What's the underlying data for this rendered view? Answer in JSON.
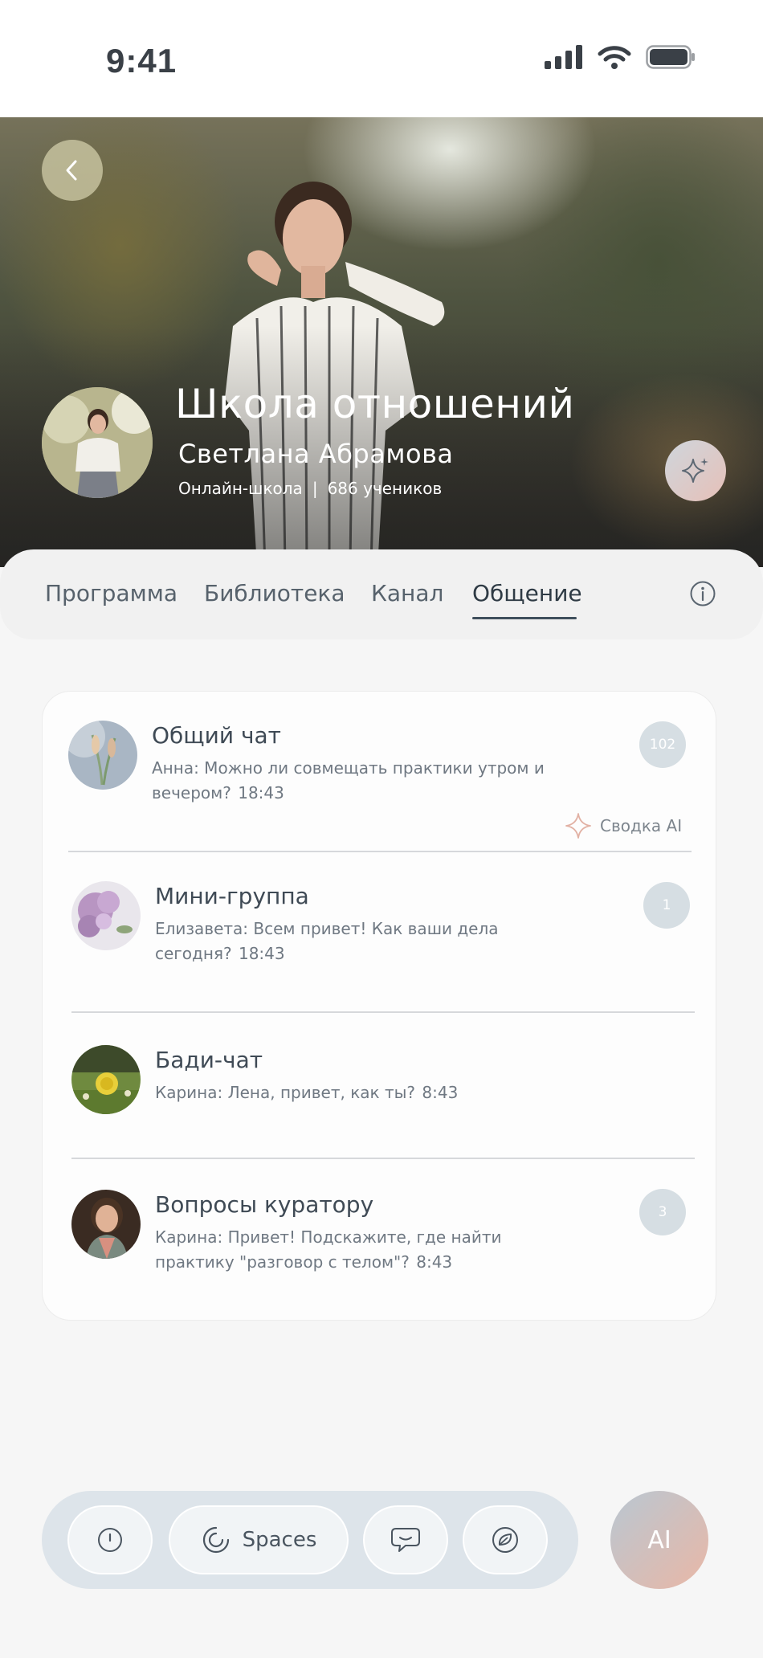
{
  "status_bar": {
    "time": "9:41"
  },
  "hero": {
    "title": "Школа отношений",
    "author": "Светлана Абрамова",
    "type": "Онлайн-школа",
    "separator": "|",
    "students": "686 учеников"
  },
  "tabs": [
    {
      "label": "Программа"
    },
    {
      "label": "Библиотека"
    },
    {
      "label": "Канал"
    },
    {
      "label": "Общение"
    }
  ],
  "chats": [
    {
      "name": "Общий чат",
      "preview": "Анна: Можно ли совмещать практики утром и вечером?",
      "time": "18:43",
      "unread": "102",
      "ai_summary": "Сводка AI"
    },
    {
      "name": "Мини-группа",
      "preview": "Елизавета: Всем привет! Как ваши дела сегодня?",
      "time": "18:43",
      "unread": "1"
    },
    {
      "name": "Бади-чат",
      "preview": "Карина: Лена, привет, как ты?",
      "time": "8:43"
    },
    {
      "name": "Вопросы куратору",
      "preview": "Карина: Привет! Подскажите, где найти практику \"разговор с телом\"?",
      "time": "8:43",
      "unread": "3"
    }
  ],
  "bottom_nav": {
    "spaces_label": "Spaces",
    "ai_label": "AI"
  },
  "icons": {
    "back": "chevron-left-icon",
    "sparkle": "sparkle-icon",
    "info": "info-icon",
    "nav_1": "clock-icon",
    "nav_2": "spaces-icon",
    "nav_3": "chat-bubble-icon",
    "nav_4": "leaf-icon"
  },
  "colors": {
    "accent": "#3f4f5c",
    "badge": "#d6dee3",
    "ai_gradient_start": "#b9c7d2",
    "ai_gradient_end": "#e9b7a6"
  }
}
